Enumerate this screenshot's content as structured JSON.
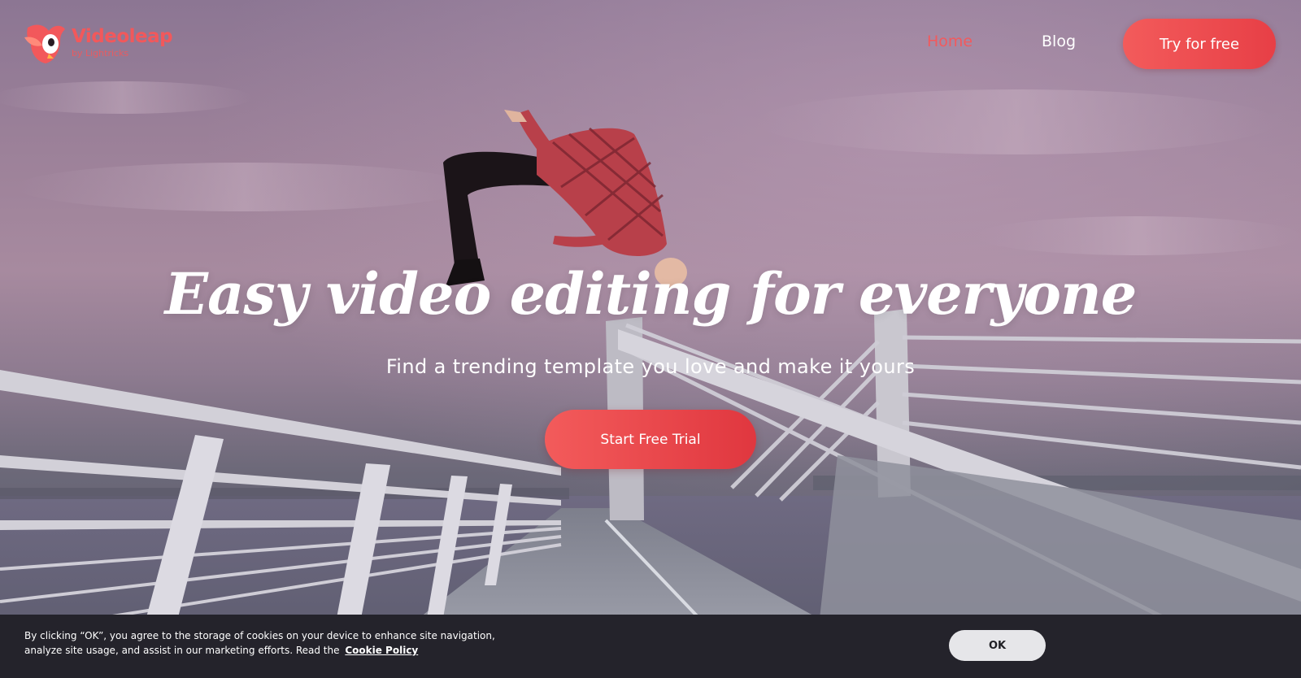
{
  "brand": {
    "name": "Videoleap",
    "byline": "by Lightricks",
    "accent_color": "#f2585b"
  },
  "nav": {
    "home_label": "Home",
    "blog_label": "Blog",
    "cta_label": "Try for free"
  },
  "hero": {
    "title": "Easy video editing for everyone",
    "subtitle": "Find a trending template you love and make it yours",
    "cta_label": "Start Free Trial"
  },
  "cookie_banner": {
    "message": "By clicking “OK”, you agree to the storage of cookies on your device to enhance site navigation, analyze site usage, and assist in our marketing efforts. Read the",
    "link_label": "Cookie Policy",
    "ok_label": "OK"
  },
  "icons": {
    "logo": "videoleap-bird-logo-icon"
  }
}
